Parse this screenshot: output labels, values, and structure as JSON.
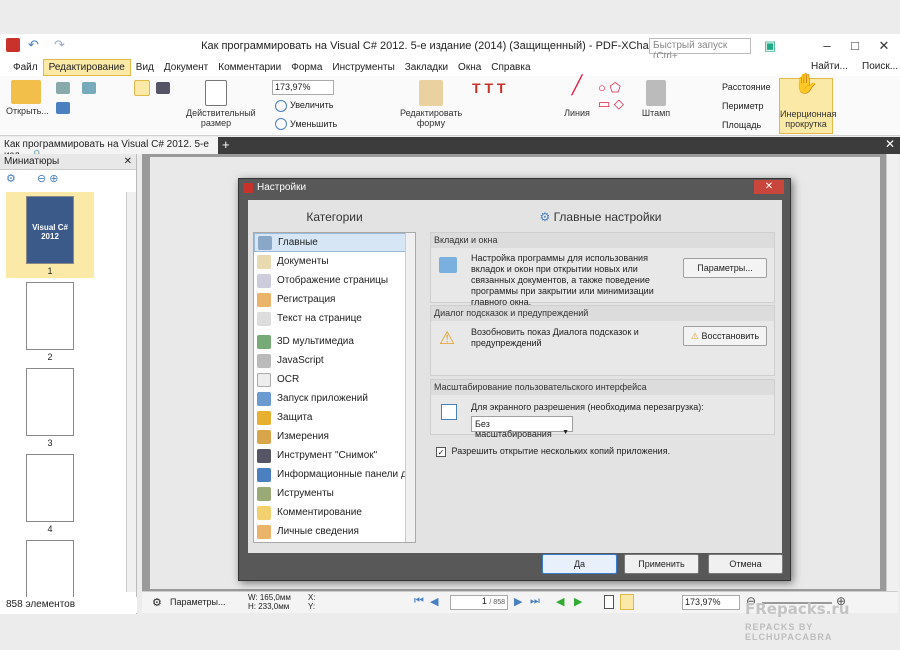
{
  "app": {
    "title": "Как программировать на Visual C# 2012. 5-е издание (2014) (Защищенный) - PDF-XChange Editor",
    "quick_launch": "Быстрый запуск (Ctrl+.",
    "find": "Найти...",
    "search": "Поиск..."
  },
  "menu": [
    "Файл",
    "Редактирование",
    "Вид",
    "Документ",
    "Комментарии",
    "Форма",
    "Инструменты",
    "Закладки",
    "Окна",
    "Справка"
  ],
  "ribbon": {
    "open": "Открыть...",
    "actual_size": "Действительный размер",
    "zoom_value": "173,97%",
    "zoom_in": "Увеличить",
    "zoom_out": "Уменьшить",
    "edit_form": "Редактировать форму",
    "line": "Линия",
    "stamp": "Штамп",
    "distance": "Расстояние",
    "perimeter": "Периметр",
    "area": "Площадь",
    "inertial_scroll": "Инерционная прокрутка"
  },
  "doc_tab": "Как программировать на Visual C# 2012. 5-е изд...",
  "thumbs": {
    "title": "Миниатюры",
    "pages": [
      "1",
      "2",
      "3",
      "4"
    ],
    "count": "858 элементов",
    "cover_title": "Visual C# 2012"
  },
  "status": {
    "params": "Параметры...",
    "w": "W: 165,0мм",
    "h": "H: 233,0мм",
    "x": "X:",
    "y": "Y:",
    "page": "1",
    "of": "/ 858",
    "zoom": "173,97%"
  },
  "dialog": {
    "title": "Настройки",
    "categories_head": "Категории",
    "main_head": "Главные настройки",
    "categories": [
      "Главные",
      "Документы",
      "Отображение страницы",
      "Регистрация",
      "Текст на странице",
      "3D мультимедиа",
      "JavaScript",
      "OCR",
      "Запуск приложений",
      "Защита",
      "Измерения",
      "Инструмент \"Снимок\"",
      "Информационные панели до",
      "Иструменты",
      "Комментирование",
      "Личные сведения"
    ],
    "g1_head": "Вкладки и окна",
    "g1_text": "Настройка программы для использования вкладок и окон при открытии новых или связанных документов, а также поведение программы при закрытии или минимизации главного окна.",
    "g1_btn": "Параметры...",
    "g2_head": "Диалог подсказок и предупреждений",
    "g2_text": "Возобновить показ Диалога подсказок и предупреждений",
    "g2_btn": "Восстановить",
    "g3_head": "Масштабирование пользовательского интерфейса",
    "g3_text": "Для экранного разрешения (необходима перезагрузка):",
    "g3_select": "Без масштабирования",
    "checkbox": "Разрешить открытие нескольких копий приложения.",
    "ok": "Да",
    "apply": "Применить",
    "cancel": "Отмена"
  },
  "watermark": {
    "brand": "FRepacks.ru",
    "sub": "REPACKS BY ELCHUPACABRA"
  },
  "colors": {
    "accent": "#e0b94a",
    "dialog_frame": "#585858",
    "close": "#c9463d",
    "sel": "#d7e6f5"
  }
}
